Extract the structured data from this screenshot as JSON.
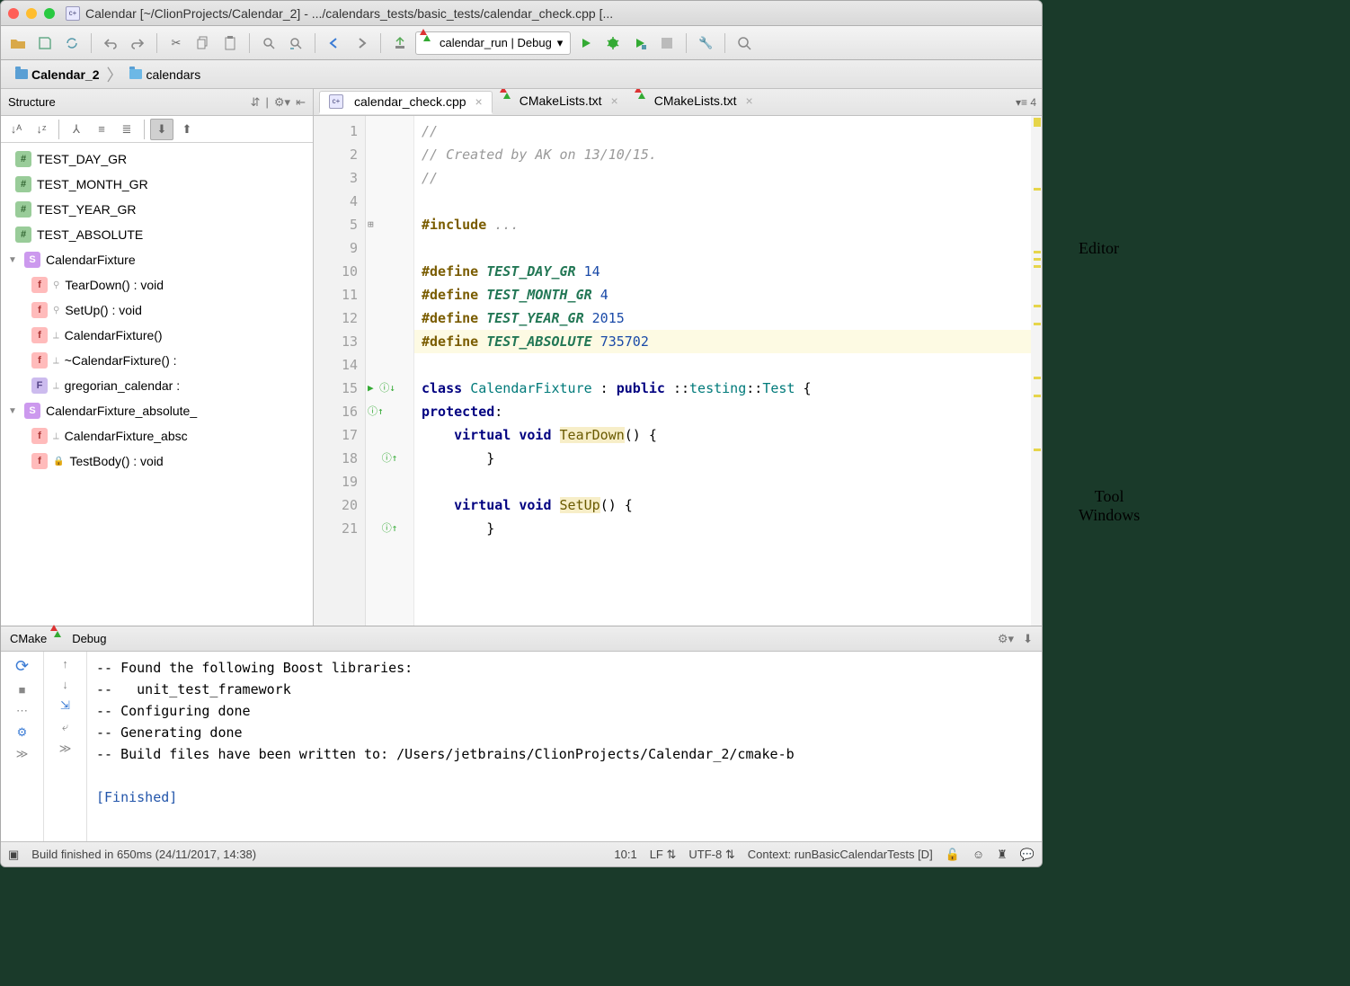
{
  "window": {
    "title": "Calendar [~/ClionProjects/Calendar_2] - .../calendars_tests/basic_tests/calendar_check.cpp [..."
  },
  "toolbar": {
    "run_config": "calendar_run | Debug"
  },
  "breadcrumbs": {
    "root": "Calendar_2",
    "child": "calendars"
  },
  "structure": {
    "title": "Structure",
    "items": [
      {
        "kind": "hash",
        "label": "TEST_DAY_GR"
      },
      {
        "kind": "hash",
        "label": "TEST_MONTH_GR"
      },
      {
        "kind": "hash",
        "label": "TEST_YEAR_GR"
      },
      {
        "kind": "hash",
        "label": "TEST_ABSOLUTE"
      }
    ],
    "class1": {
      "label": "CalendarFixture",
      "members": [
        {
          "kind": "f",
          "label": "TearDown() : void"
        },
        {
          "kind": "f",
          "label": "SetUp() : void"
        },
        {
          "kind": "f",
          "label": "CalendarFixture()"
        },
        {
          "kind": "f",
          "label": "~CalendarFixture() :"
        },
        {
          "kind": "fi",
          "label": "gregorian_calendar :"
        }
      ]
    },
    "class2": {
      "label": "CalendarFixture_absolute_",
      "members": [
        {
          "kind": "f",
          "label": "CalendarFixture_absc"
        },
        {
          "kind": "f",
          "label": "TestBody() : void"
        }
      ]
    }
  },
  "tabs": [
    {
      "label": "calendar_check.cpp",
      "icon": "cpp",
      "active": true
    },
    {
      "label": "CMakeLists.txt",
      "icon": "cmake",
      "active": false
    },
    {
      "label": "CMakeLists.txt",
      "icon": "cmake",
      "active": false
    }
  ],
  "tabs_extra": "≡ 4",
  "editor": {
    "gutter": [
      "1",
      "2",
      "3",
      "4",
      "5",
      "9",
      "10",
      "11",
      "12",
      "13",
      "14",
      "15",
      "16",
      "17",
      "18",
      "19",
      "20",
      "21"
    ],
    "lines": [
      {
        "t": "cm",
        "text": "//"
      },
      {
        "t": "cm",
        "text": "// Created by AK on 13/10/15."
      },
      {
        "t": "cm",
        "text": "//"
      },
      {
        "t": "",
        "text": ""
      },
      {
        "t": "inc",
        "text": "#include ..."
      },
      {
        "t": "",
        "text": ""
      },
      {
        "t": "def",
        "mac": "TEST_DAY_GR",
        "val": "14"
      },
      {
        "t": "def",
        "mac": "TEST_MONTH_GR",
        "val": "4"
      },
      {
        "t": "def",
        "mac": "TEST_YEAR_GR",
        "val": "2015"
      },
      {
        "t": "def",
        "mac": "TEST_ABSOLUTE",
        "val": "735702",
        "hl": true
      },
      {
        "t": "",
        "text": ""
      },
      {
        "t": "cls",
        "text": "class CalendarFixture : public ::testing::Test {"
      },
      {
        "t": "prot",
        "text": "protected:"
      },
      {
        "t": "vfn",
        "name": "TearDown"
      },
      {
        "t": "close",
        "text": "        }"
      },
      {
        "t": "",
        "text": ""
      },
      {
        "t": "vfn",
        "name": "SetUp"
      },
      {
        "t": "close",
        "text": "        }"
      }
    ]
  },
  "cmake": {
    "title": "CMake",
    "tab": "Debug",
    "lines": [
      "-- Found the following Boost libraries:",
      "--   unit_test_framework",
      "-- Configuring done",
      "-- Generating done",
      "-- Build files have been written to: /Users/jetbrains/ClionProjects/Calendar_2/cmake-b"
    ],
    "finished": "[Finished]"
  },
  "status": {
    "build": "Build finished in 650ms (24/11/2017, 14:38)",
    "pos": "10:1",
    "lf": "LF",
    "enc": "UTF-8",
    "ctx": "Context: runBasicCalendarTests [D]"
  },
  "annotations": {
    "editor": "Editor",
    "tool": "Tool\nWindows"
  }
}
